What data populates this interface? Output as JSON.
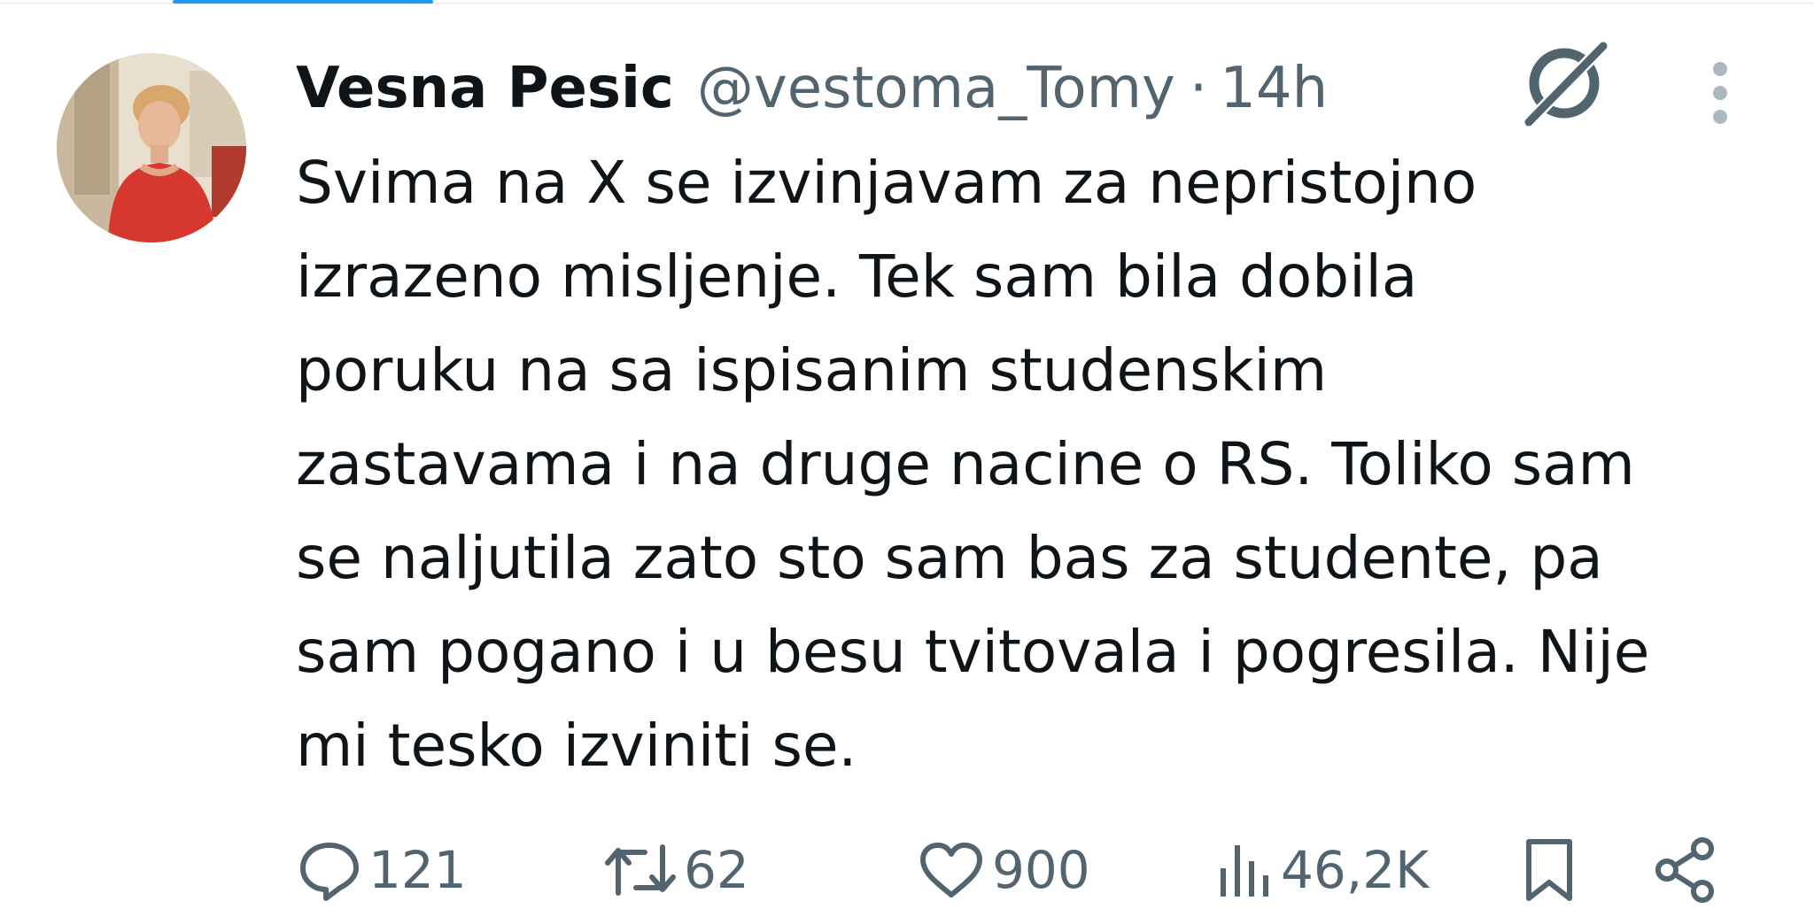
{
  "tweet": {
    "author": {
      "display_name": "Vesna Pesic",
      "handle": "@vestoma_Tomy",
      "separator": "·",
      "time": "14h"
    },
    "text_lines": [
      "Svima na X se izvinjavam za nepristojno",
      "izrazeno misljenje. Tek sam bila dobila",
      "poruku na sa ispisanim studenskim",
      "zastavama i na druge nacine o RS. Toliko sam",
      "se naljutila zato sto sam bas za studente, pa",
      "sam pogano i u besu tvitovala i pogresila. Nije",
      "mi tesko izviniti se."
    ],
    "stats": {
      "replies": "121",
      "reposts": "62",
      "likes": "900",
      "views": "46,2K"
    }
  },
  "icons": {
    "reply": "reply-bubble-icon",
    "repost": "repost-arrows-icon",
    "like": "heart-icon",
    "views": "bar-chart-icon",
    "bookmark": "bookmark-icon",
    "share": "share-icon",
    "grok": "grok-icon",
    "more": "more-vertical-icon"
  },
  "colors": {
    "text_primary": "#0f1419",
    "text_secondary": "#536471",
    "accent": "#1d9bf0"
  }
}
